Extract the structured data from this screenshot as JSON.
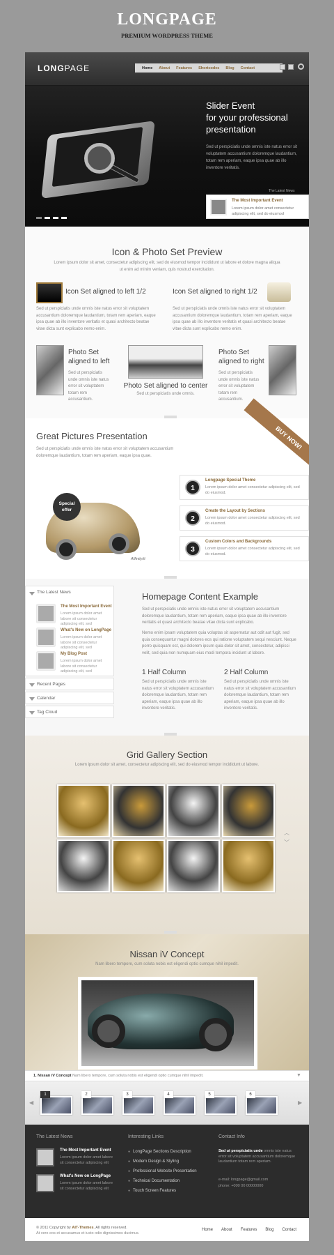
{
  "header": {
    "title": "LONGPAGE",
    "subtitle": "PREMIUM WORDPRESS THEME"
  },
  "topbar": {
    "logo_a": "LONG",
    "logo_b": "PAGE",
    "nav": [
      "Home",
      "About",
      "Features",
      "Shortcodes",
      "Blog",
      "Contact"
    ]
  },
  "slider": {
    "title_lines": [
      "Slider Event",
      "for your professional",
      "presentation"
    ],
    "text": "Sed ut perspiciatis unde omnis iste natus error sit voluptatem accusantium doloremque laudantium, totam rem aperiam, eaque ipsa quae ab illo inventore veritatis.",
    "latest_label": "The Latest News",
    "news_title": "The Most Important Event",
    "news_text": "Lorem ipsum dolor amet consectetur adipiscing elit, sed do eiusmod"
  },
  "iconset": {
    "title": "Icon & Photo Set Preview",
    "intro": "Lorem ipsum dolor sit amet, consectetur adipiscing elit, sed do eiusmod tempor incididunt ut labore et dolore magna aliqua ut enim ad minim veniam, quis nostrud exercitation.",
    "left_title": "Icon Set aligned to left 1/2",
    "right_title": "Icon Set aligned to right 1/2",
    "body": "Sed ut perspiciatis unde omnis iste natus error sit voluptatem accusantium doloremque laudantium, totam rem aperiam, eaque ipsa quae ab illo inventore veritatis et quasi architecto beatae vitae dicta sunt explicabo nemo enim.",
    "p1a": "Photo Set",
    "p1b": "aligned to left",
    "p2": "Photo Set aligned to center",
    "p2d": "Sed ut perspiciatis unde omnis.",
    "p3a": "Photo Set",
    "p3b": "aligned to right",
    "pdesc": "Sed ut perspiciatis unde omnis iste natus error sit voluptatem totam rem accusantium."
  },
  "pictures": {
    "title": "Great Pictures Presentation",
    "intro": "Sed ut perspiciatis unde omnis iste natus error sit voluptatem accusantium doloremque laudantium, totam rem aperiam, eaque ipsa quae.",
    "buy": "BUY NOW!",
    "special_a": "Special",
    "special_b": "offer",
    "brand": "Affinity/it",
    "features": [
      {
        "n": "1",
        "t": "Longpage Special Theme",
        "d": "Lorem ipsum dolor amet consectetur adipiscing elit, sed do eiusmod."
      },
      {
        "n": "2",
        "t": "Create the Layout by Sections",
        "d": "Lorem ipsum dolor amet consectetur adipiscing elit, sed do eiusmod."
      },
      {
        "n": "3",
        "t": "Custom Colors and Backgrounds",
        "d": "Lorem ipsum dolor amet consectetur adipiscing elit, sed do eiusmod."
      }
    ]
  },
  "sidebar": {
    "latest": "The Latest News",
    "items": [
      {
        "t": "The Most Important Event",
        "d": "Lorem ipsum dolor amet labore sit consectetur adipiscing elit, sed"
      },
      {
        "t": "What's New on LongPage",
        "d": "Lorem ipsum dolor amet labore sit consectetur adipiscing elit, sed"
      },
      {
        "t": "My Blog Post",
        "d": "Lorem ipsum dolor amet labore sit consectetur adipiscing elit, sed"
      }
    ],
    "recent": "Recent Pages",
    "calendar": "Calendar",
    "tags": "Tag Cloud"
  },
  "homepage": {
    "title": "Homepage Content Example",
    "p1": "Sed ut perspiciatis unde omnis iste natus error sit voluptatem accusantium doloremque laudantium, totam rem aperiam, eaque ipsa quae ab illo inventore veritatis et quasi architecto beatae vitae dicta sunt explicabo.",
    "p2": "Nemo enim ipsam voluptatem quia voluptas sit aspernatur aut odit aut fugit, sed quia consequuntur magni dolores eos qui ratione voluptatem sequi nesciunt. Neque porro quisquam est, qui dolorem ipsum quia dolor sit amet, consectetur, adipisci velit, sed quia non numquam eius modi tempora incidunt ut labore.",
    "h1": "1 Half Column",
    "h2": "2 Half Column",
    "c": "Sed ut perspiciatis unde omnis iste natus error sit voluptatem accusantium doloremque laudantium, totam rem aperiam, eaque ipsa quae ab illo inventore veritatis."
  },
  "gallery": {
    "title": "Grid Gallery Section",
    "intro": "Lorem ipsum dolor sit amet, consectetur adipiscing elit, sed do eiusmod tempor incididunt ut labore."
  },
  "concept": {
    "title": "Nissan iV Concept",
    "sub": "Nam libero tempore, cum soluta nobis est eligendi optio cumque nihil impedit.",
    "cap_b": "1. Nissan iV Concept",
    "cap": "Nam libero tempore, cum soluta nobis est eligendi optio cumque nihil impedit.",
    "nums": [
      "1",
      "2",
      "3",
      "4",
      "5",
      "6"
    ]
  },
  "footer": {
    "h1": "The Latest News",
    "h2": "Interesting Links",
    "h3": "Contact Info",
    "n1t": "The Most Important Event",
    "n1d": "Lorem ipsum dolor amet labore sit consectetur adipiscing elit",
    "n2t": "What's New on LongPage",
    "n2d": "Lorem ipsum dolor amet labore sit consectetur adipiscing elit",
    "links": [
      "LongPage Sections Description",
      "Modern Design & Styling",
      "Professional Website Presentation",
      "Technical Documentation",
      "Touch Screen Features"
    ],
    "c_bold": "Sed ut perspiciatis unde",
    "c_rest": "omnis iste natus error sit voluptatem accusantium doloremque laudantium totam rem aperiam.",
    "email": "e-mail: longpage@gmail.com",
    "phone": "phone: +000 00 00000000",
    "copy_a": "© 2011 Copyright by",
    "copy_b": "AIT-Themes",
    "copy_c": ". All rights reserved.",
    "copy_d": "At vero eos et accusamus et iusto odio dignissimos ducimus.",
    "nav": [
      "Home",
      "About",
      "Features",
      "Blog",
      "Contact"
    ]
  }
}
